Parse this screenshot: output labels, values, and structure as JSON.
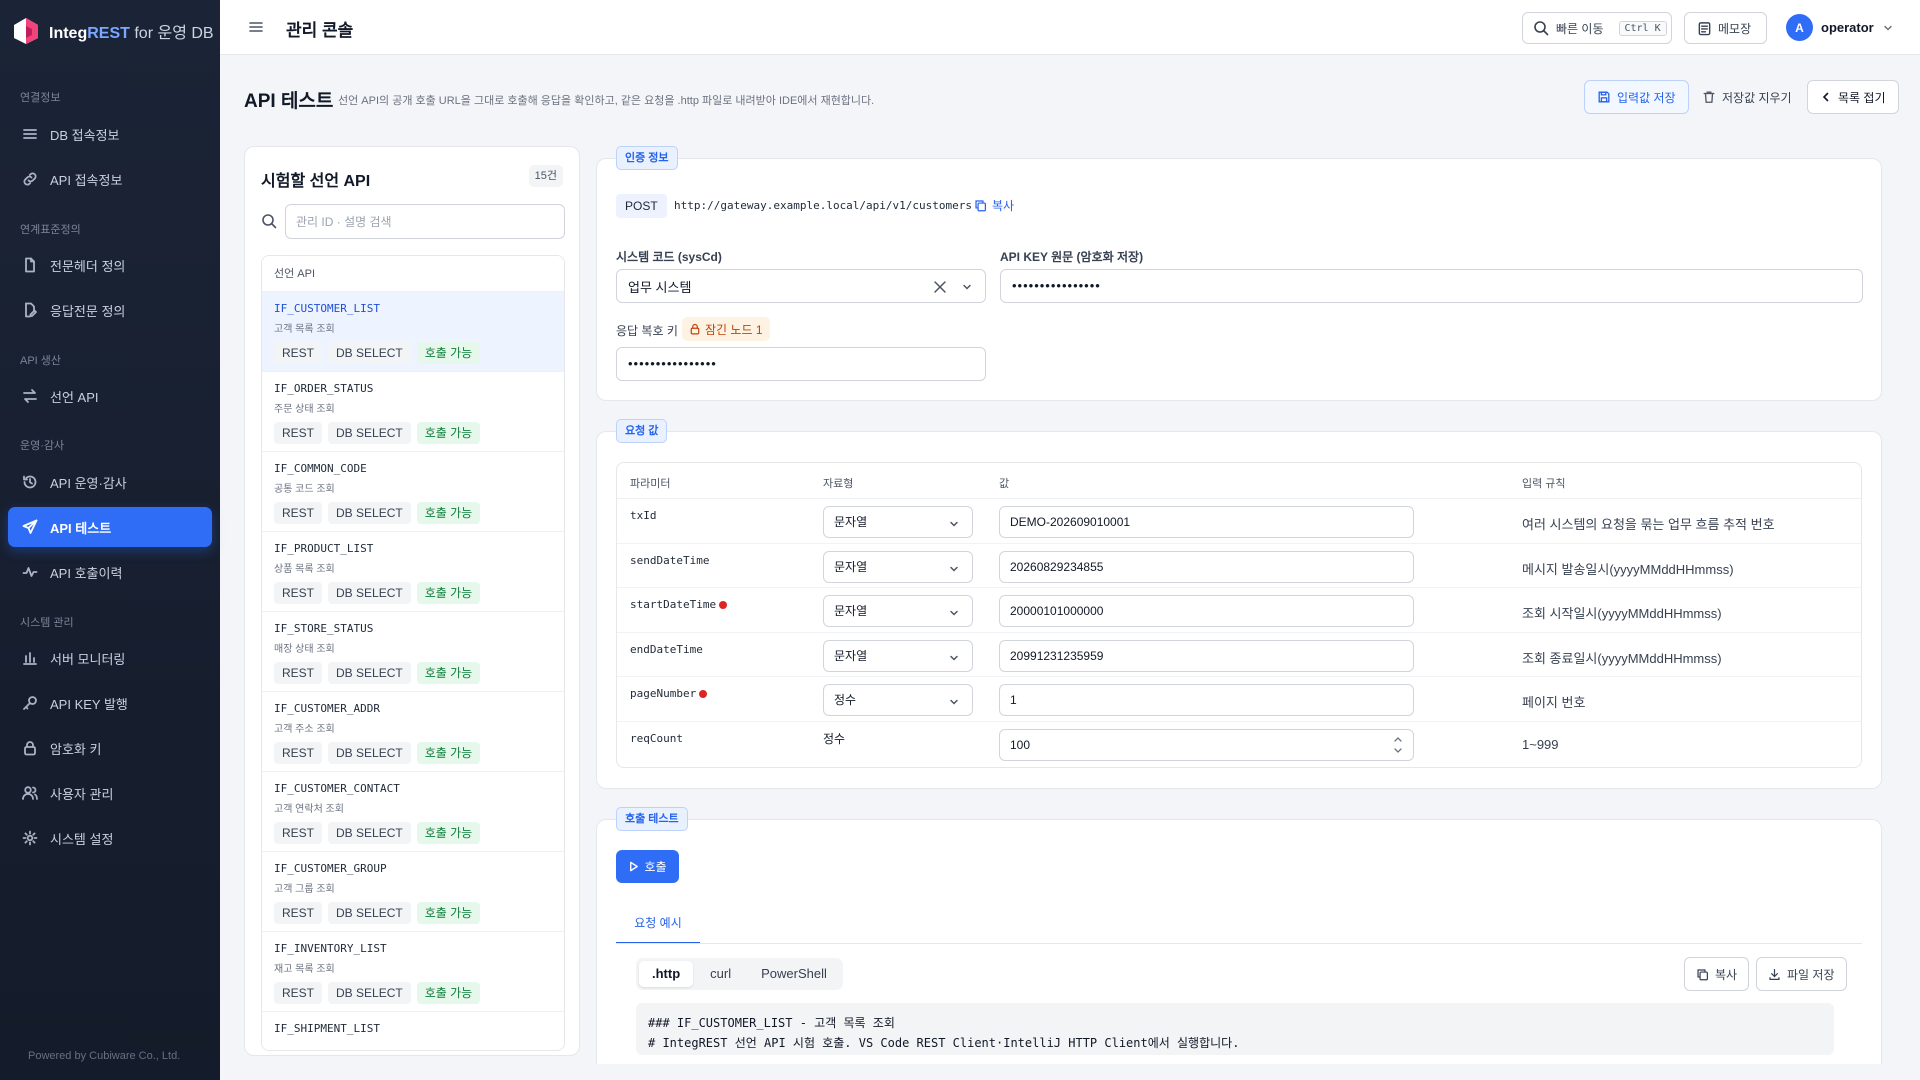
{
  "brand": {
    "name_a": "Integ",
    "name_b": "REST",
    "suffix": "for",
    "db": "운영 DB"
  },
  "sidebar": {
    "sections": [
      {
        "label": "연결정보",
        "items": [
          {
            "label": "DB 접속정보"
          },
          {
            "label": "API 접속정보"
          }
        ]
      },
      {
        "label": "연계표준정의",
        "items": [
          {
            "label": "전문헤더 정의"
          },
          {
            "label": "응답전문 정의"
          }
        ]
      },
      {
        "label": "API 생산",
        "items": [
          {
            "label": "선언 API"
          }
        ]
      },
      {
        "label": "운영·감사",
        "items": [
          {
            "label": "API 운영·감사"
          },
          {
            "label": "API 테스트"
          },
          {
            "label": "API 호출이력"
          }
        ]
      },
      {
        "label": "시스템 관리",
        "items": [
          {
            "label": "서버 모니터링"
          },
          {
            "label": "API KEY 발행"
          },
          {
            "label": "암호화 키"
          },
          {
            "label": "사용자 관리"
          },
          {
            "label": "시스템 설정"
          }
        ]
      }
    ],
    "footer": "Powered by Cubiware Co., Ltd."
  },
  "topbar": {
    "title": "관리 콘솔",
    "quick_nav": "빠른 이동",
    "quick_nav_kbd": "Ctrl K",
    "memo": "메모장",
    "user_initial": "A",
    "user_name": "operator"
  },
  "page": {
    "title": "API 테스트",
    "description": "선언 API의 공개 호출 URL을 그대로 호출해 응답을 확인하고, 같은 요청을 .http 파일로 내려받아 IDE에서 재현합니다.",
    "save_inputs": "입력값 저장",
    "clear_saved": "저장값 지우기",
    "collapse_list": "목록 접기"
  },
  "api_list": {
    "title": "시험할 선언 API",
    "count": "15건",
    "search_placeholder": "관리 ID · 설명 검색",
    "column_header": "선언 API",
    "items": [
      {
        "id": "IF_CUSTOMER_LIST",
        "desc": "고객 목록 조회",
        "tags": [
          "REST",
          "DB SELECT",
          "호출 가능"
        ]
      },
      {
        "id": "IF_ORDER_STATUS",
        "desc": "주문 상태 조회",
        "tags": [
          "REST",
          "DB SELECT",
          "호출 가능"
        ]
      },
      {
        "id": "IF_COMMON_CODE",
        "desc": "공통 코드 조회",
        "tags": [
          "REST",
          "DB SELECT",
          "호출 가능"
        ]
      },
      {
        "id": "IF_PRODUCT_LIST",
        "desc": "상품 목록 조회",
        "tags": [
          "REST",
          "DB SELECT",
          "호출 가능"
        ]
      },
      {
        "id": "IF_STORE_STATUS",
        "desc": "매장 상태 조회",
        "tags": [
          "REST",
          "DB SELECT",
          "호출 가능"
        ]
      },
      {
        "id": "IF_CUSTOMER_ADDR",
        "desc": "고객 주소 조회",
        "tags": [
          "REST",
          "DB SELECT",
          "호출 가능"
        ]
      },
      {
        "id": "IF_CUSTOMER_CONTACT",
        "desc": "고객 연락처 조회",
        "tags": [
          "REST",
          "DB SELECT",
          "호출 가능"
        ]
      },
      {
        "id": "IF_CUSTOMER_GROUP",
        "desc": "고객 그룹 조회",
        "tags": [
          "REST",
          "DB SELECT",
          "호출 가능"
        ]
      },
      {
        "id": "IF_INVENTORY_LIST",
        "desc": "재고 목록 조회",
        "tags": [
          "REST",
          "DB SELECT",
          "호출 가능"
        ]
      },
      {
        "id": "IF_SHIPMENT_LIST",
        "desc": "",
        "tags": []
      }
    ]
  },
  "auth": {
    "legend": "인증 정보",
    "method": "POST",
    "url": "http://gateway.example.local/api/v1/customers",
    "copy": "복사",
    "syscd_label": "시스템 코드 (sysCd)",
    "syscd_value": "업무 시스템",
    "apikey_label": "API KEY 원문 (암호화 저장)",
    "apikey_value": "••••••••••••••••",
    "decrypt_label": "응답 복호 키",
    "lock_badge": "잠긴 노드 1",
    "decrypt_value": "••••••••••••••••"
  },
  "request": {
    "legend": "요청 값",
    "headers": {
      "param": "파라미터",
      "type": "자료형",
      "value": "값",
      "rule": "입력 규칙"
    },
    "rows": [
      {
        "name": "txId",
        "required": false,
        "type": "문자열",
        "type_select": true,
        "value": "DEMO-202609010001",
        "rule": "여러 시스템의 요청을 묶는 업무 흐름 추적 번호"
      },
      {
        "name": "sendDateTime",
        "required": false,
        "type": "문자열",
        "type_select": true,
        "value": "20260829234855",
        "rule": "메시지 발송일시(yyyyMMddHHmmss)"
      },
      {
        "name": "startDateTime",
        "required": true,
        "type": "문자열",
        "type_select": true,
        "value": "20000101000000",
        "rule": "조회 시작일시(yyyyMMddHHmmss)"
      },
      {
        "name": "endDateTime",
        "required": false,
        "type": "문자열",
        "type_select": true,
        "value": "20991231235959",
        "rule": "조회 종료일시(yyyyMMddHHmmss)"
      },
      {
        "name": "pageNumber",
        "required": true,
        "type": "정수",
        "type_select": true,
        "value": "1",
        "rule": "페이지 번호"
      },
      {
        "name": "reqCount",
        "required": false,
        "type": "정수",
        "type_select": false,
        "value": "100",
        "rule": "1~999",
        "spinner": true
      }
    ]
  },
  "call": {
    "legend": "호출 테스트",
    "button": "호출",
    "tab": "요청 예시",
    "formats": [
      ".http",
      "curl",
      "PowerShell"
    ],
    "active_format": ".http",
    "copy": "복사",
    "save_file": "파일 저장",
    "code_lines": [
      "### IF_CUSTOMER_LIST - 고객 목록 조회",
      "# IntegREST 선언 API 시험 호출. VS Code REST Client·IntelliJ HTTP Client에서 실행합니다."
    ]
  },
  "colors": {
    "accent": "#2f6df6",
    "sidebar_bg": "#1b2436",
    "ok_green": "#15803d",
    "danger": "#dc2626"
  }
}
